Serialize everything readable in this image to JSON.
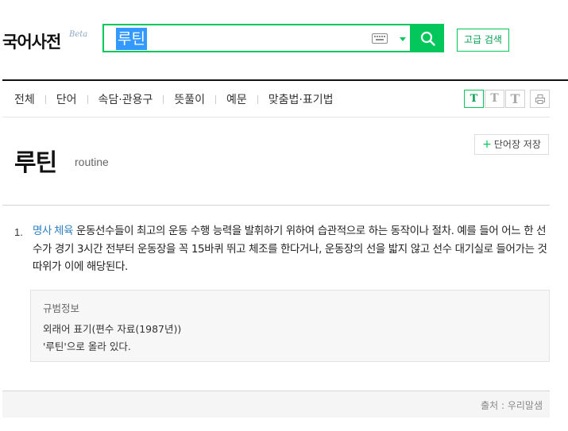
{
  "header": {
    "logo": "국어사전",
    "beta_badge": "Beta",
    "search": {
      "value": "루틴",
      "placeholder": ""
    },
    "advanced_search_label": "고급 검색"
  },
  "tabs": [
    {
      "label": "전체"
    },
    {
      "label": "단어"
    },
    {
      "label": "속담·관용구"
    },
    {
      "label": "뜻풀이"
    },
    {
      "label": "예문"
    },
    {
      "label": "맞춤법·표기법"
    }
  ],
  "font_size_buttons": [
    "T",
    "T",
    "T"
  ],
  "entry": {
    "headword": "루틴",
    "origin": "routine",
    "save_label": "단어장 저장",
    "definitions": [
      {
        "number": "1.",
        "pos": "명사",
        "field": "체육",
        "text": "운동선수들이 최고의 운동 수행 능력을 발휘하기 위하여 습관적으로 하는 동작이나 절차. 예를 들어 어느 한 선수가 경기 3시간 전부터 운동장을 꼭 15바퀴 뛰고 체조를 한다거나, 운동장의 선을 밟지 않고 선수 대기실로 들어가는 것 따위가 이에 해당된다."
      }
    ],
    "norm_info": {
      "title": "규범정보",
      "line1": "외래어 표기(편수 자료(1987년))",
      "line2": "'루틴'으로 올라 있다."
    }
  },
  "footer": {
    "source": "출처 : 우리말샘"
  },
  "colors": {
    "accent": "#03c75a",
    "link": "#2f80c2",
    "selection": "#3399ff"
  },
  "icons": [
    "keyboard-icon",
    "chevron-down-icon",
    "search-icon",
    "print-icon",
    "plus-icon"
  ]
}
